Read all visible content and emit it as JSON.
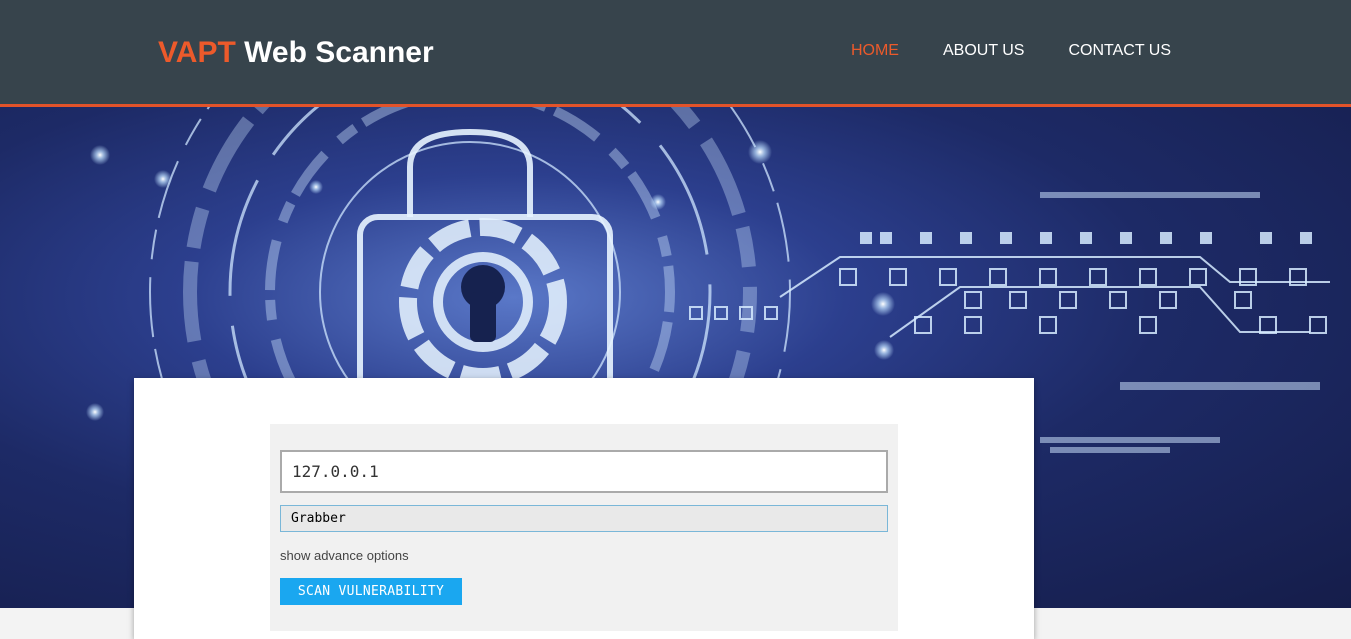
{
  "header": {
    "brand_accent": "VAPT",
    "brand_rest": "Web Scanner",
    "nav": [
      {
        "label": "HOME",
        "active": true
      },
      {
        "label": "ABOUT US",
        "active": false
      },
      {
        "label": "CONTACT US",
        "active": false
      }
    ]
  },
  "hero": {
    "image": "padlock-circuit-illustration"
  },
  "scan_form": {
    "target_value": "127.0.0.1",
    "tool_selected": "Grabber",
    "advance_link": "show advance options",
    "scan_button": "SCAN VULNERABILITY"
  },
  "colors": {
    "header_bg": "#37444c",
    "accent": "#ec5a2b",
    "button": "#1aa7f0"
  }
}
